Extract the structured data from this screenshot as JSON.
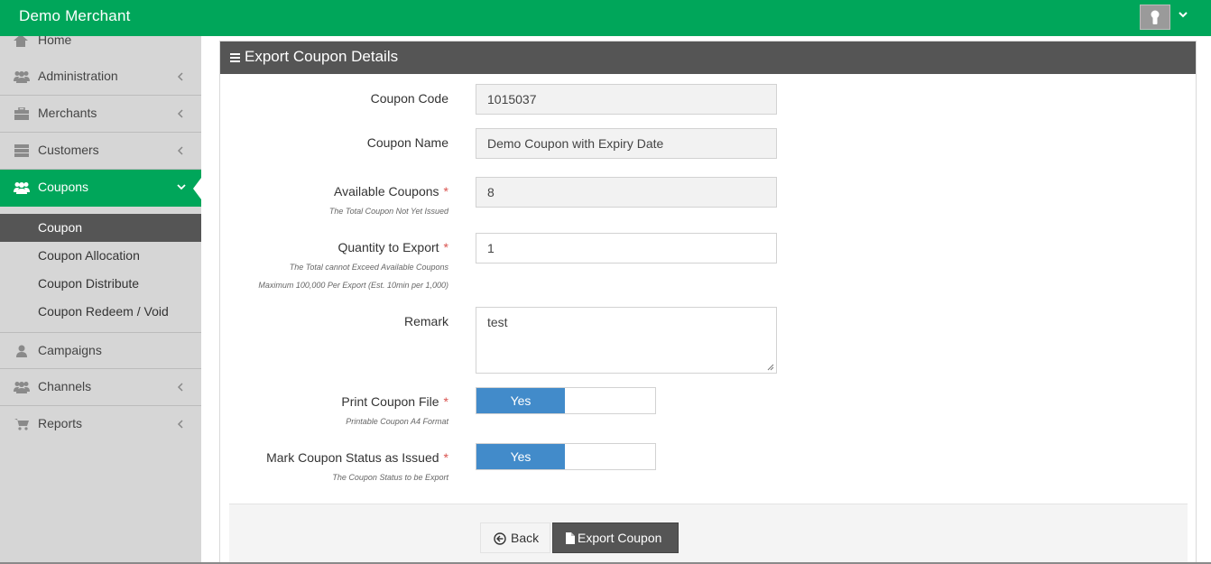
{
  "app": {
    "brand": "Demo Merchant"
  },
  "sidebar": {
    "home": "Home",
    "items": [
      {
        "label": "Administration",
        "icon": "users-icon"
      },
      {
        "label": "Merchants",
        "icon": "briefcase-icon"
      },
      {
        "label": "Customers",
        "icon": "server-icon"
      },
      {
        "label": "Coupons",
        "icon": "users-icon",
        "active": true
      },
      {
        "label": "Campaigns",
        "icon": "user-icon"
      },
      {
        "label": "Channels",
        "icon": "users-icon"
      },
      {
        "label": "Reports",
        "icon": "cart-icon"
      }
    ],
    "coupon_sub": [
      "Coupon",
      "Coupon Allocation",
      "Coupon Distribute",
      "Coupon Redeem / Void"
    ]
  },
  "panel": {
    "title": "Export Coupon Details"
  },
  "form": {
    "coupon_code": {
      "label": "Coupon Code",
      "value": "1015037"
    },
    "coupon_name": {
      "label": "Coupon Name",
      "value": "Demo Coupon with Expiry Date"
    },
    "available": {
      "label": "Available Coupons",
      "help": "The Total Coupon Not Yet Issued",
      "value": "8"
    },
    "quantity": {
      "label": "Quantity to Export",
      "help1": "The Total cannot Exceed Available Coupons",
      "help2": "Maximum 100,000 Per Export (Est. 10min per 1,000)",
      "value": "1"
    },
    "remark": {
      "label": "Remark",
      "value": "test"
    },
    "print_file": {
      "label": "Print Coupon File",
      "help": "Printable Coupon A4 Format",
      "toggle": "Yes"
    },
    "mark_issued": {
      "label": "Mark Coupon Status as Issued",
      "help": "The Coupon Status to be Export",
      "toggle": "Yes"
    },
    "required_mark": "*"
  },
  "buttons": {
    "back": "Back",
    "export": "Export Coupon"
  },
  "colors": {
    "brand": "#00a65a",
    "header": "#555555",
    "toggle_on": "#428bca",
    "required": "#d9534f"
  }
}
